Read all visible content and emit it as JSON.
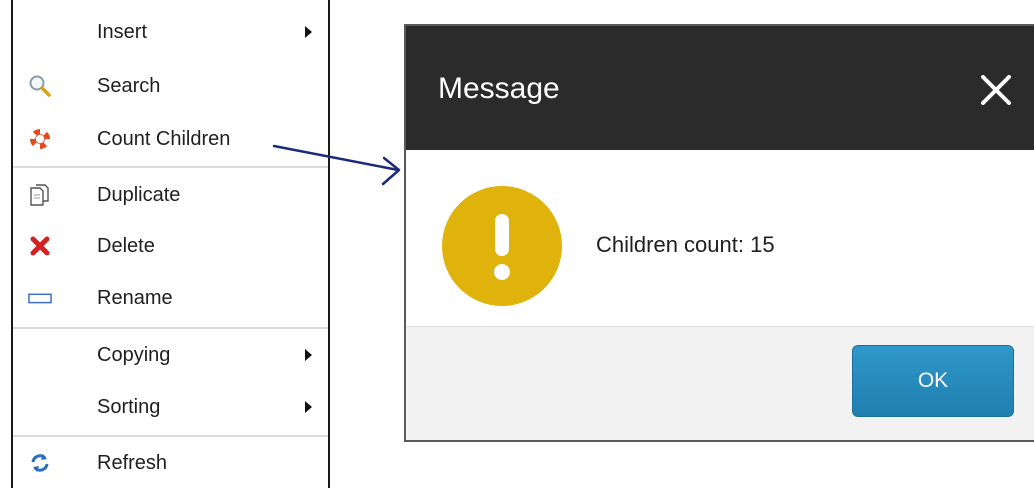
{
  "context_menu": {
    "items": [
      {
        "label": "Insert",
        "icon": null,
        "submenu": true
      },
      {
        "label": "Search",
        "icon": "search-icon",
        "submenu": false
      },
      {
        "label": "Count Children",
        "icon": "lifebuoy-icon",
        "submenu": false
      },
      {
        "label": "Duplicate",
        "icon": "duplicate-icon",
        "submenu": false
      },
      {
        "label": "Delete",
        "icon": "delete-icon",
        "submenu": false
      },
      {
        "label": "Rename",
        "icon": "rename-icon",
        "submenu": false
      },
      {
        "label": "Copying",
        "icon": null,
        "submenu": true
      },
      {
        "label": "Sorting",
        "icon": null,
        "submenu": true
      },
      {
        "label": "Refresh",
        "icon": "refresh-icon",
        "submenu": false
      }
    ]
  },
  "dialog": {
    "title": "Message",
    "message": "Children count: 15",
    "ok_label": "OK",
    "icon": "warning-icon"
  },
  "colors": {
    "dialog_header": "#2b2b2b",
    "warning": "#e0b20c",
    "ok_button": "#2589bd",
    "connector_arrow": "#1c2a7a",
    "delete_icon": "#d42020",
    "refresh_icon": "#2a6cc0"
  }
}
